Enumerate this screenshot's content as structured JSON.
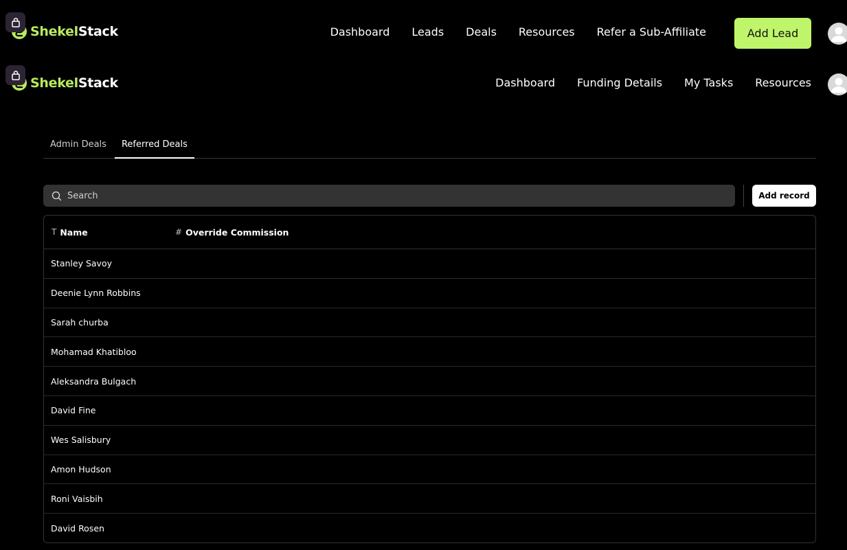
{
  "header_primary": {
    "logo": {
      "part1": "Shekel",
      "part2": "Stack"
    },
    "nav": [
      "Dashboard",
      "Leads",
      "Deals",
      "Resources",
      "Refer a Sub-Affiliate"
    ],
    "cta_label": "Add Lead"
  },
  "header_secondary": {
    "logo": {
      "part1": "Shekel",
      "part2": "Stack"
    },
    "nav": [
      "Dashboard",
      "Funding Details",
      "My Tasks",
      "Resources"
    ]
  },
  "tabs": [
    {
      "label": "Admin Deals",
      "active": false
    },
    {
      "label": "Referred Deals",
      "active": true
    }
  ],
  "search": {
    "placeholder": "Search"
  },
  "add_record_label": "Add record",
  "table": {
    "columns": [
      {
        "label": "Name",
        "icon": "text-type-icon",
        "glyph": "T"
      },
      {
        "label": "Override Commission",
        "icon": "number-hash-icon",
        "glyph": "#"
      }
    ],
    "rows": [
      {
        "name": "Stanley Savoy",
        "override_commission": ""
      },
      {
        "name": "Deenie Lynn Robbins",
        "override_commission": ""
      },
      {
        "name": "Sarah churba",
        "override_commission": ""
      },
      {
        "name": "Mohamad Khatibloo",
        "override_commission": ""
      },
      {
        "name": "Aleksandra Bulgach",
        "override_commission": ""
      },
      {
        "name": "David Fine",
        "override_commission": ""
      },
      {
        "name": "Wes Salisbury",
        "override_commission": ""
      },
      {
        "name": "Amon Hudson",
        "override_commission": ""
      },
      {
        "name": "Roni Vaisbih",
        "override_commission": ""
      },
      {
        "name": "David Rosen",
        "override_commission": ""
      }
    ]
  },
  "colors": {
    "background": "#000000",
    "brand_green": "#b8ea5f",
    "cta_green": "#bff56b",
    "search_bg": "#333333",
    "lock_badge": "#2d2433"
  }
}
